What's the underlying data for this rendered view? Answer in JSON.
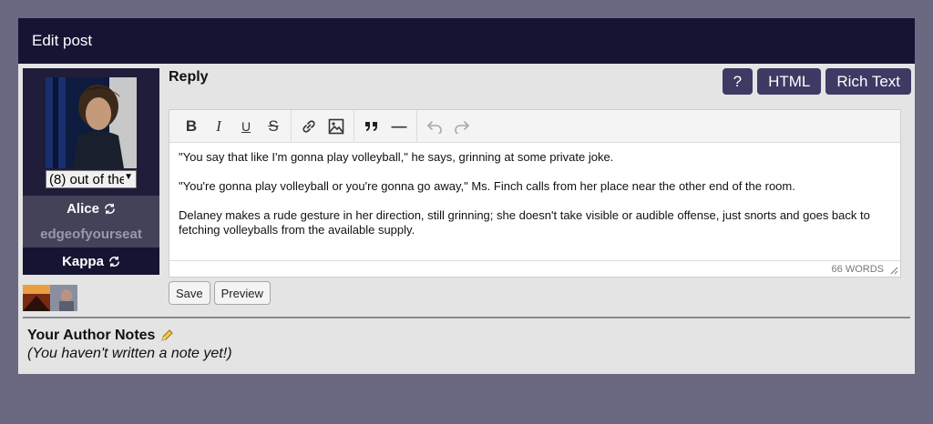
{
  "header": {
    "title": "Edit post"
  },
  "sidebar": {
    "select_value": "(8) out of the",
    "characters": [
      {
        "name": "Alice"
      },
      {
        "name": "edgeofyourseat"
      },
      {
        "name": "Kappa"
      }
    ]
  },
  "reply": {
    "label": "Reply",
    "mode_buttons": [
      "?",
      "HTML",
      "Rich Text"
    ]
  },
  "toolbar": {
    "bold": "B",
    "italic": "I",
    "underline": "U",
    "strike": "S",
    "hr": "—"
  },
  "editor": {
    "paragraphs": [
      "\"You say that like I'm gonna play volleyball,\" he says, grinning at some private joke.",
      "\"You're gonna play volleyball or you're gonna go away,\" Ms. Finch calls from her place near the other end of the room.",
      "Delaney makes a rude gesture in her direction, still grinning; she doesn't take visible or audible offense, just snorts and goes back to fetching volleyballs from the available supply."
    ],
    "word_count": "66 WORDS"
  },
  "actions": {
    "save": "Save",
    "preview": "Preview"
  },
  "notes": {
    "title": "Your Author Notes",
    "text": "(You haven't written a note yet!)"
  },
  "colors": {
    "header_bg": "#151433",
    "button_bg": "#3d3a63",
    "page_bg": "#6b6882"
  }
}
